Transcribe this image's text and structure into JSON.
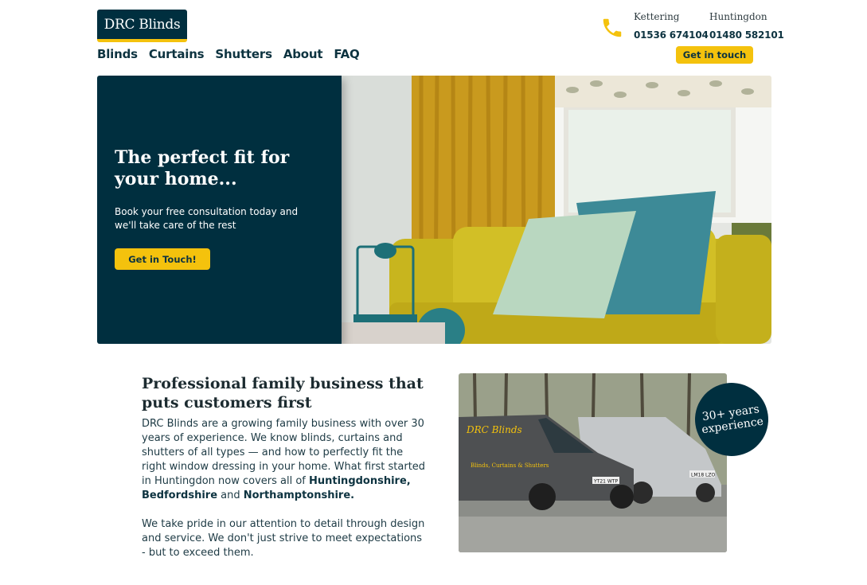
{
  "brand": {
    "name": "DRC Blinds"
  },
  "nav": [
    "Blinds",
    "Curtains",
    "Shutters",
    "About",
    "FAQ"
  ],
  "contacts": [
    {
      "town": "Kettering",
      "phone": "01536 674104"
    },
    {
      "town": "Huntingdon",
      "phone": "01480 582101"
    }
  ],
  "header": {
    "cta": "Get in touch"
  },
  "hero": {
    "title_pre": "The ",
    "title_bold": "perfect fit",
    "title_post": " for your home...",
    "subtitle": "Book your free consultation today and we'll take care of the rest",
    "button": "Get in Touch!"
  },
  "about": {
    "title": "Professional family business that puts customers first",
    "para1_text": "DRC Blinds are a growing family business with over 30 years of experience. We know blinds, curtains and shutters of all types — and how to perfectly fit the right window dressing in your home. What first started in Huntingdon now covers all of ",
    "region1": "Huntingdonshire,",
    "region2": "Bedfordshire",
    "and_text": " and ",
    "region3": "Northamptonshire.",
    "para2": "We take pride in our attention to detail through design and service. We don't just strive to meet expectations - but to exceed them.",
    "badge": "30+ years experience"
  },
  "van": {
    "brand_text": "DRC Blinds",
    "side_text": "Blinds, Curtains & Shutters",
    "plate1": "YT21 WTP",
    "plate2": "LM18 LZO"
  },
  "colors": {
    "navy": "#002f3f",
    "accent": "#f4c20d",
    "text": "#0d3340"
  }
}
